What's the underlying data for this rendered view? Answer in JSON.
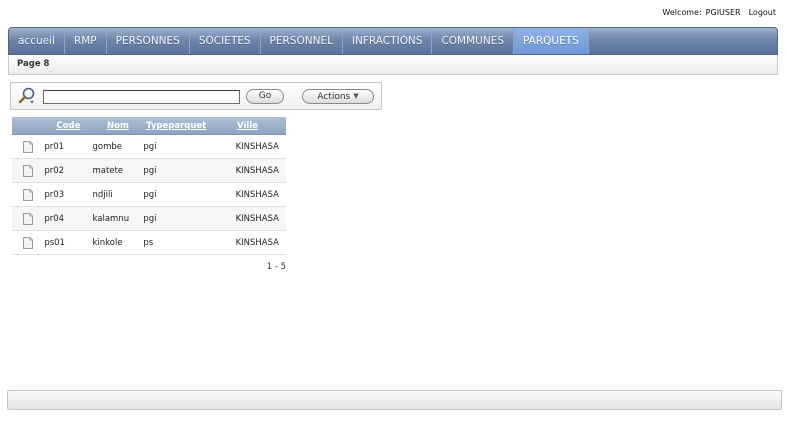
{
  "header": {
    "welcome_label": "Welcome:",
    "username": "PGIUSER",
    "logout_label": "Logout"
  },
  "tabs": [
    {
      "label": "accueil",
      "active": false
    },
    {
      "label": "RMP",
      "active": false
    },
    {
      "label": "PERSONNES",
      "active": false
    },
    {
      "label": "SOCIETES",
      "active": false
    },
    {
      "label": "PERSONNEL",
      "active": false
    },
    {
      "label": "INFRACTIONS",
      "active": false
    },
    {
      "label": "COMMUNES",
      "active": false
    },
    {
      "label": "PARQUETS",
      "active": true
    }
  ],
  "breadcrumb": {
    "title": "Page 8"
  },
  "search": {
    "value": "",
    "go_label": "Go",
    "actions_label": "Actions"
  },
  "report": {
    "columns": [
      "Code",
      "Nom",
      "Typeparquet",
      "Ville"
    ],
    "rows": [
      [
        "pr01",
        "gombe",
        "pgi",
        "KINSHASA"
      ],
      [
        "pr02",
        "matete",
        "pgi",
        "KINSHASA"
      ],
      [
        "pr03",
        "ndjili",
        "pgi",
        "KINSHASA"
      ],
      [
        "pr04",
        "kalamnu",
        "pgi",
        "KINSHASA"
      ],
      [
        "ps01",
        "kinkole",
        "ps",
        "KINSHASA"
      ]
    ],
    "pagination": "1 - 5"
  },
  "colors": {
    "tab_bar": "#6f86ac",
    "tab_active": "#7fa4de",
    "table_header": "#9fb2cc"
  }
}
